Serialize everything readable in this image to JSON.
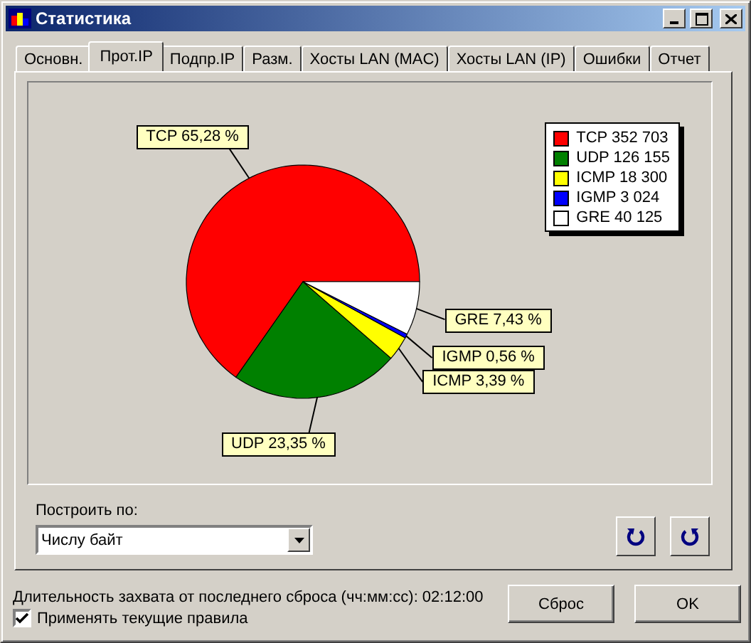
{
  "window": {
    "title": "Статистика"
  },
  "tabs": [
    {
      "label": "Основн.",
      "selected": false
    },
    {
      "label": "Прот.IP",
      "selected": true
    },
    {
      "label": "Подпр.IP",
      "selected": false
    },
    {
      "label": "Разм.",
      "selected": false
    },
    {
      "label": "Хосты LAN (MAC)",
      "selected": false
    },
    {
      "label": "Хосты LAN (IP)",
      "selected": false
    },
    {
      "label": "Ошибки",
      "selected": false
    },
    {
      "label": "Отчет",
      "selected": false
    }
  ],
  "chart": {
    "chart_data": {
      "type": "pie",
      "categories": [
        "TCP",
        "UDP",
        "ICMP",
        "IGMP",
        "GRE"
      ],
      "values": [
        65.28,
        23.35,
        3.39,
        0.56,
        7.43
      ],
      "value_labels": [
        "65,28 %",
        "23,35 %",
        "3,39 %",
        "0,56 %",
        "7,43 %"
      ]
    },
    "legend": [
      {
        "value": "352 703",
        "color": "#ff0000"
      },
      {
        "value": "126 155",
        "color": "#008000"
      },
      {
        "value": "18 300",
        "color": "#ffff00"
      },
      {
        "value": "3 024",
        "color": "#0000ff"
      },
      {
        "value": "40 125",
        "color": "#ffffff"
      }
    ]
  },
  "build_by": {
    "label": "Построить по:",
    "value": "Числу байт"
  },
  "capture_duration": "Длительность захвата от последнего сброса (чч:мм:сс): 02:12:00",
  "apply_rules": {
    "label": "Применять текущие правила",
    "checked": true
  },
  "buttons": [
    "Сброс",
    "OK"
  ]
}
